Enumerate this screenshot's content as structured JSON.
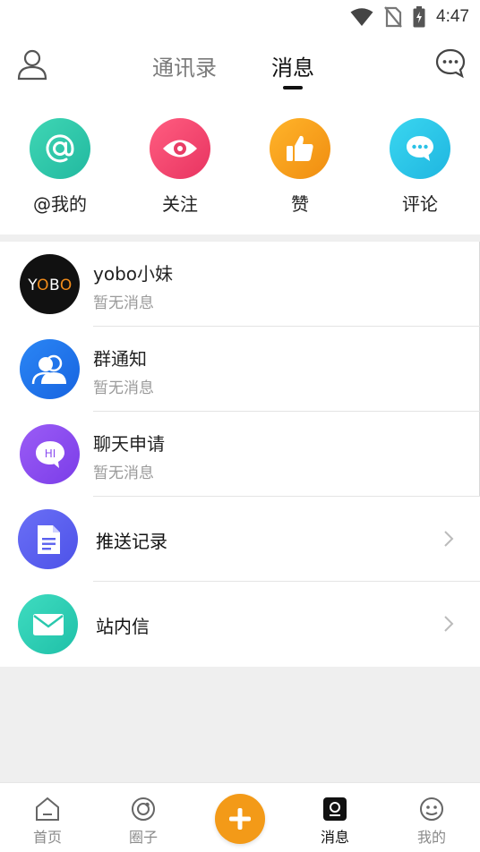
{
  "status_bar": {
    "time": "4:47",
    "icons": [
      "wifi-icon",
      "no-sim-icon",
      "battery-charging-icon"
    ]
  },
  "header": {
    "tabs": [
      {
        "label": "通讯录",
        "active": false
      },
      {
        "label": "消息",
        "active": true
      }
    ],
    "left_icon": "user-profile-icon",
    "right_icon": "chat-bubble-icon"
  },
  "categories": [
    {
      "label": "@我的",
      "icon": "at-icon",
      "color": "#2ec9a8"
    },
    {
      "label": "关注",
      "icon": "eye-icon",
      "color": "#f0476f"
    },
    {
      "label": "赞",
      "icon": "thumbs-up-icon",
      "color": "#f6a01c"
    },
    {
      "label": "评论",
      "icon": "comment-icon",
      "color": "#2ec7e6"
    }
  ],
  "conversations": [
    {
      "title": "yobo小妹",
      "subtitle": "暂无消息",
      "avatar_text": "YOBO",
      "avatar_color": "#111111"
    },
    {
      "title": "群通知",
      "subtitle": "暂无消息",
      "avatar_icon": "group-icon",
      "avatar_color": "#1f73f0"
    },
    {
      "title": "聊天申请",
      "subtitle": "暂无消息",
      "avatar_text": "HI",
      "avatar_color": "#8a4cf0"
    }
  ],
  "links": [
    {
      "title": "推送记录",
      "icon": "document-icon",
      "color": "#5b63f0"
    },
    {
      "title": "站内信",
      "icon": "mail-icon",
      "color": "#26ccb0"
    }
  ],
  "bottom_nav": {
    "items": [
      {
        "label": "首页",
        "icon": "home-icon",
        "active": false
      },
      {
        "label": "圈子",
        "icon": "circle-icon",
        "active": false
      },
      {
        "label": "消息",
        "icon": "messages-icon",
        "active": true
      },
      {
        "label": "我的",
        "icon": "smiley-icon",
        "active": false
      }
    ],
    "publish_icon": "plus-icon",
    "publish_color": "#f39a18"
  }
}
